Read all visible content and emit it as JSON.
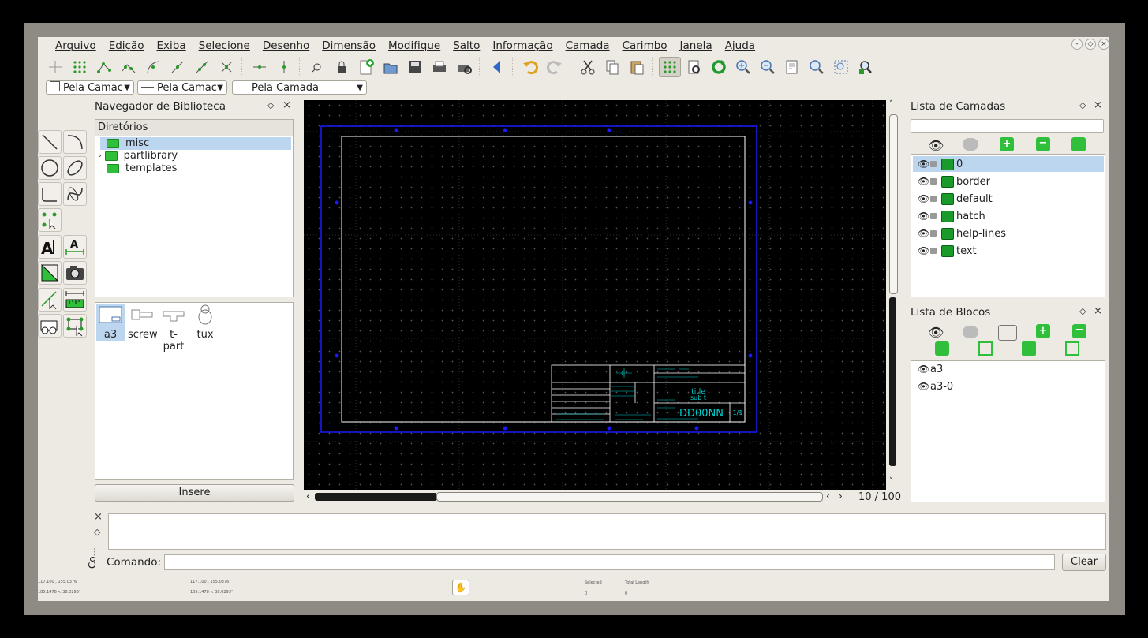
{
  "window_controls": [
    "-",
    "◇",
    "×"
  ],
  "menu": [
    "Arquivo",
    "Edição",
    "Exiba",
    "Selecione",
    "Desenho",
    "Dimensão",
    "Modifique",
    "Salto",
    "Informação",
    "Camada",
    "Carimbo",
    "Janela",
    "Ajuda"
  ],
  "pen_toolbar": {
    "color": "Pela Camac",
    "width": "Pela Camac",
    "linetype": "Pela Camada"
  },
  "library": {
    "title": "Navegador de Biblioteca",
    "tree_header": "Diretórios",
    "dirs": [
      "misc",
      "partlibrary",
      "templates"
    ],
    "items": [
      "a3",
      "screw",
      "t-part",
      "tux"
    ],
    "insert_button": "Insere"
  },
  "layers": {
    "title": "Lista de Camadas",
    "search_placeholder": "",
    "items": [
      "0",
      "border",
      "default",
      "hatch",
      "help-lines",
      "text"
    ]
  },
  "blocks": {
    "title": "Lista de Blocos",
    "items": [
      "a3",
      "a3-0"
    ]
  },
  "canvas": {
    "page_counter": "10 / 100",
    "title_block": {
      "title": "title",
      "subtitle": "sub t",
      "drawing_no": "DD00NN",
      "sheet": "1/1"
    }
  },
  "command": {
    "side_label": "Co...",
    "label": "Comando:",
    "input_value": "",
    "clear_button": "Clear"
  },
  "statusbar": {
    "coord_abs_1": "117.100 , 155.0376",
    "coord_abs_2": "185.1478 < 38.0293°",
    "coord_rel_1": "117.100 , 155.0376",
    "coord_rel_2": "185.1478 < 38.0293°",
    "selected_label": "Selected",
    "selected_value": "0",
    "length_label": "Total Length",
    "length_value": "0"
  },
  "colors": {
    "canvas_bg": "#000000",
    "page_border": "#1a1aff",
    "drawing_frame": "#ffffff",
    "title_text": "#00d0d0",
    "panel_bg": "#ede9e3",
    "accent_green": "#22a832"
  }
}
